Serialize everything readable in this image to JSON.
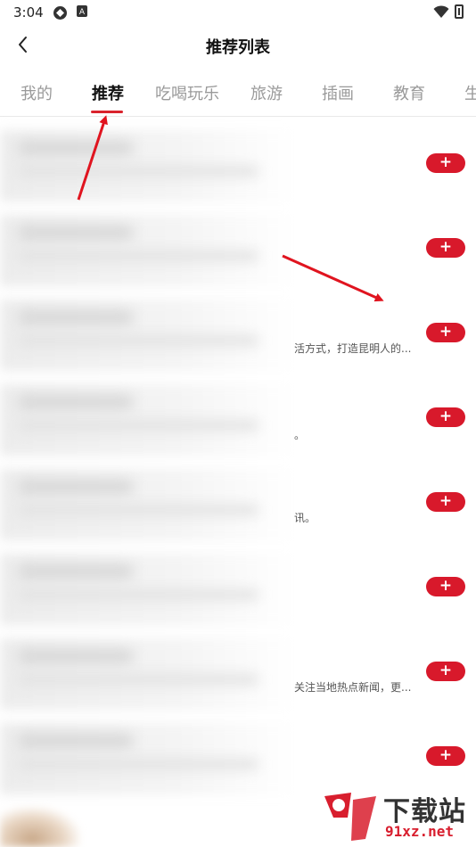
{
  "status_bar": {
    "time": "3:04",
    "icons": [
      "sync-icon",
      "app-badge-icon",
      "wifi-icon",
      "battery-icon"
    ]
  },
  "header": {
    "title": "推荐列表",
    "back_icon": "chevron-left-icon"
  },
  "tabs": [
    {
      "label": "我的",
      "active": false
    },
    {
      "label": "推荐",
      "active": true
    },
    {
      "label": "吃喝玩乐",
      "active": false
    },
    {
      "label": "旅游",
      "active": false
    },
    {
      "label": "插画",
      "active": false
    },
    {
      "label": "教育",
      "active": false
    },
    {
      "label": "生",
      "active": false
    }
  ],
  "accent_color": "#d8192b",
  "list": {
    "rows": [
      {
        "desc": "",
        "button": "+"
      },
      {
        "desc": "",
        "button": "+"
      },
      {
        "desc": "活方式，打造昆明人的...",
        "button": "+"
      },
      {
        "desc": "。",
        "button": "+"
      },
      {
        "desc": "讯。",
        "button": "+"
      },
      {
        "desc": "",
        "button": "+"
      },
      {
        "desc": "关注当地热点新闻，更...",
        "button": "+"
      },
      {
        "desc": "",
        "button": "+"
      }
    ]
  },
  "watermark": {
    "name": "下载站",
    "url": "91xz.net"
  }
}
